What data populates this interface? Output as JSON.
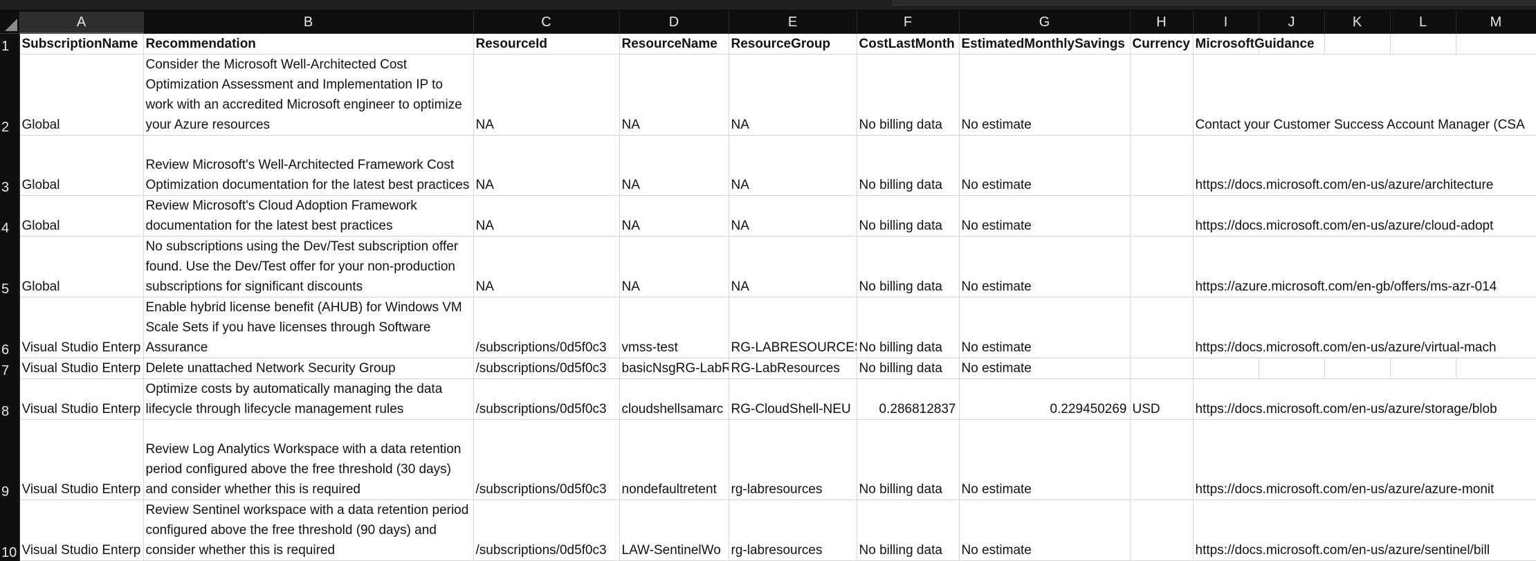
{
  "columns": [
    "A",
    "B",
    "C",
    "D",
    "E",
    "F",
    "G",
    "H",
    "I",
    "J",
    "K",
    "L",
    "M"
  ],
  "rows": [
    {
      "num": "1",
      "A": "SubscriptionName",
      "B": "Recommendation",
      "C": "ResourceId",
      "D": "ResourceName",
      "E": "ResourceGroup",
      "F": "CostLastMonth",
      "G": "EstimatedMonthlySavings",
      "H": "Currency",
      "I": "MicrosoftGuidance"
    },
    {
      "num": "2",
      "A": "Global",
      "B": "Consider the Microsoft Well-Architected Cost Optimization Assessment and Implementation IP to work with an accredited Microsoft engineer to optimize your Azure resources",
      "C": "NA",
      "D": "NA",
      "E": "NA",
      "F": "No billing data",
      "G": "No estimate",
      "H": "",
      "I": "Contact your Customer Success Account Manager (CSA"
    },
    {
      "num": "3",
      "A": "Global",
      "B": "Review Microsoft's Well-Architected Framework Cost Optimization documentation for the latest best practices",
      "C": "NA",
      "D": "NA",
      "E": "NA",
      "F": "No billing data",
      "G": "No estimate",
      "H": "",
      "I": "https://docs.microsoft.com/en-us/azure/architecture"
    },
    {
      "num": "4",
      "A": "Global",
      "B": "Review Microsoft's Cloud Adoption Framework documentation for the latest best practices",
      "C": "NA",
      "D": "NA",
      "E": "NA",
      "F": "No billing data",
      "G": "No estimate",
      "H": "",
      "I": "https://docs.microsoft.com/en-us/azure/cloud-adopt"
    },
    {
      "num": "5",
      "A": "Global",
      "B": "No subscriptions using the Dev/Test subscription offer found. Use the Dev/Test offer for your non-production subscriptions for significant discounts",
      "C": "NA",
      "D": "NA",
      "E": "NA",
      "F": "No billing data",
      "G": "No estimate",
      "H": "",
      "I": "https://azure.microsoft.com/en-gb/offers/ms-azr-014"
    },
    {
      "num": "6",
      "A": "Visual Studio Enterp",
      "B": "Enable hybrid license benefit (AHUB) for Windows VM Scale Sets if you have licenses through Software Assurance",
      "C": "/subscriptions/0d5f0c3",
      "D": "vmss-test",
      "E": "RG-LABRESOURCES",
      "F": "No billing data",
      "G": "No estimate",
      "H": "",
      "I": "https://docs.microsoft.com/en-us/azure/virtual-mach"
    },
    {
      "num": "7",
      "A": "Visual Studio Enterp",
      "B": "Delete unattached Network Security Group",
      "C": "/subscriptions/0d5f0c3",
      "D": "basicNsgRG-LabR",
      "E": "RG-LabResources",
      "F": "No billing data",
      "G": "No estimate",
      "H": "",
      "I": ""
    },
    {
      "num": "8",
      "A": "Visual Studio Enterp",
      "B": "Optimize costs by automatically managing the data lifecycle through lifecycle management rules",
      "C": "/subscriptions/0d5f0c3",
      "D": "cloudshellsamarc",
      "E": "RG-CloudShell-NEU",
      "F": "0.286812837",
      "G": "0.229450269",
      "H": "USD",
      "I": "https://docs.microsoft.com/en-us/azure/storage/blob"
    },
    {
      "num": "9",
      "A": "Visual Studio Enterp",
      "B": "Review Log Analytics Workspace with a data retention period configured above the free threshold (30 days) and consider whether this is required",
      "C": "/subscriptions/0d5f0c3",
      "D": "nondefaultretent",
      "E": "rg-labresources",
      "F": "No billing data",
      "G": "No estimate",
      "H": "",
      "I": "https://docs.microsoft.com/en-us/azure/azure-monit"
    },
    {
      "num": "10",
      "A": "Visual Studio Enterp",
      "B": "Review Sentinel workspace with a data retention period configured above the free threshold (90 days) and consider whether this is required",
      "C": "/subscriptions/0d5f0c3",
      "D": "LAW-SentinelWo",
      "E": "rg-labresources",
      "F": "No billing data",
      "G": "No estimate",
      "H": "",
      "I": "https://docs.microsoft.com/en-us/azure/sentinel/bill"
    }
  ]
}
